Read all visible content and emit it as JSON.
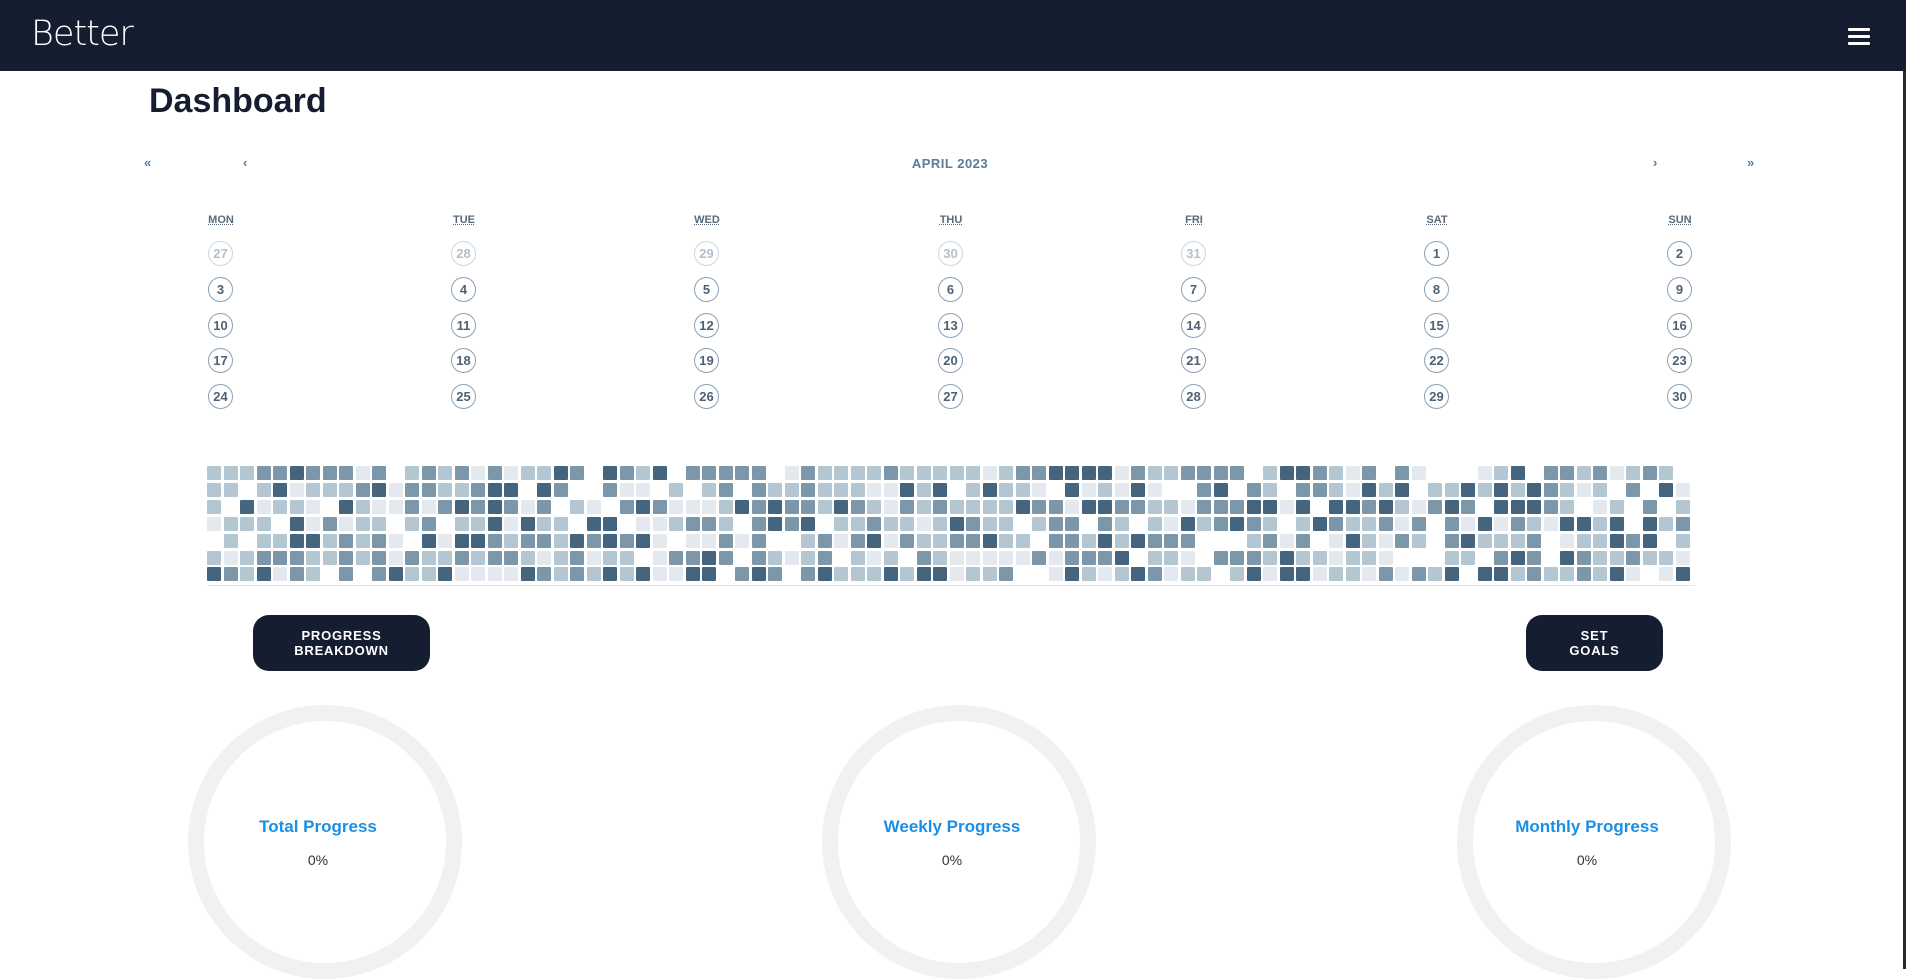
{
  "app": {
    "brand": "Better",
    "menu_icon": "hamburger-menu-icon"
  },
  "page": {
    "title": "Dashboard"
  },
  "calendar": {
    "title": "APRIL 2023",
    "nav": {
      "prev_year": "«",
      "prev_month": "‹",
      "next_month": "›",
      "next_year": "»"
    },
    "weekdays": [
      "MON",
      "TUE",
      "WED",
      "THU",
      "FRI",
      "SAT",
      "SUN"
    ],
    "weeks": [
      [
        {
          "d": "27",
          "muted": true
        },
        {
          "d": "28",
          "muted": true
        },
        {
          "d": "29",
          "muted": true
        },
        {
          "d": "30",
          "muted": true
        },
        {
          "d": "31",
          "muted": true
        },
        {
          "d": "1",
          "muted": false
        },
        {
          "d": "2",
          "muted": false
        }
      ],
      [
        {
          "d": "3",
          "muted": false
        },
        {
          "d": "4",
          "muted": false
        },
        {
          "d": "5",
          "muted": false
        },
        {
          "d": "6",
          "muted": false
        },
        {
          "d": "7",
          "muted": false
        },
        {
          "d": "8",
          "muted": false
        },
        {
          "d": "9",
          "muted": false
        }
      ],
      [
        {
          "d": "10",
          "muted": false
        },
        {
          "d": "11",
          "muted": false
        },
        {
          "d": "12",
          "muted": false
        },
        {
          "d": "13",
          "muted": false
        },
        {
          "d": "14",
          "muted": false
        },
        {
          "d": "15",
          "muted": false
        },
        {
          "d": "16",
          "muted": false
        }
      ],
      [
        {
          "d": "17",
          "muted": false
        },
        {
          "d": "18",
          "muted": false
        },
        {
          "d": "19",
          "muted": false
        },
        {
          "d": "20",
          "muted": false
        },
        {
          "d": "21",
          "muted": false
        },
        {
          "d": "22",
          "muted": false
        },
        {
          "d": "23",
          "muted": false
        }
      ],
      [
        {
          "d": "24",
          "muted": false
        },
        {
          "d": "25",
          "muted": false
        },
        {
          "d": "26",
          "muted": false
        },
        {
          "d": "27",
          "muted": false
        },
        {
          "d": "28",
          "muted": false
        },
        {
          "d": "29",
          "muted": false
        },
        {
          "d": "30",
          "muted": false
        }
      ]
    ]
  },
  "heatmap": {
    "rows": 7,
    "columns": 90,
    "shades": [
      "#ffffff",
      "#e3e9ee",
      "#b5c6d3",
      "#7d97aa",
      "#45647d"
    ]
  },
  "actions": {
    "progress_breakdown": "PROGRESS\nBREAKDOWN",
    "set_goals": "SET\nGOALS"
  },
  "progress": [
    {
      "label": "Total Progress",
      "value": "0%",
      "fraction": 0
    },
    {
      "label": "Weekly Progress",
      "value": "0%",
      "fraction": 0
    },
    {
      "label": "Monthly Progress",
      "value": "0%",
      "fraction": 0
    }
  ],
  "colors": {
    "navbar": "#151e30",
    "accent_link": "#1a8fe6",
    "calendar_text": "#5a7d9a",
    "ring_track": "#f1f1f1"
  }
}
